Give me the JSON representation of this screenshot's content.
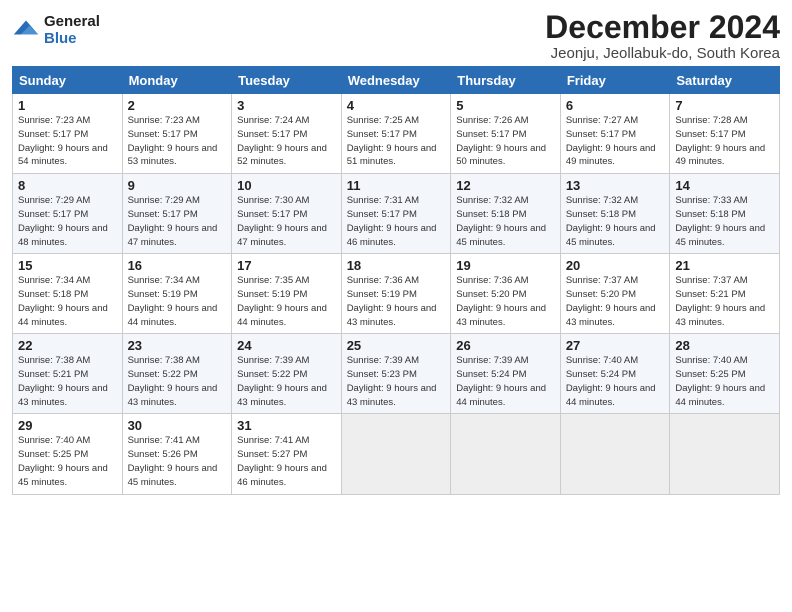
{
  "logo": {
    "general": "General",
    "blue": "Blue"
  },
  "title": {
    "month": "December 2024",
    "location": "Jeonju, Jeollabuk-do, South Korea"
  },
  "weekdays": [
    "Sunday",
    "Monday",
    "Tuesday",
    "Wednesday",
    "Thursday",
    "Friday",
    "Saturday"
  ],
  "weeks": [
    [
      {
        "day": "1",
        "sunrise": "7:23 AM",
        "sunset": "5:17 PM",
        "daylight": "9 hours and 54 minutes."
      },
      {
        "day": "2",
        "sunrise": "7:23 AM",
        "sunset": "5:17 PM",
        "daylight": "9 hours and 53 minutes."
      },
      {
        "day": "3",
        "sunrise": "7:24 AM",
        "sunset": "5:17 PM",
        "daylight": "9 hours and 52 minutes."
      },
      {
        "day": "4",
        "sunrise": "7:25 AM",
        "sunset": "5:17 PM",
        "daylight": "9 hours and 51 minutes."
      },
      {
        "day": "5",
        "sunrise": "7:26 AM",
        "sunset": "5:17 PM",
        "daylight": "9 hours and 50 minutes."
      },
      {
        "day": "6",
        "sunrise": "7:27 AM",
        "sunset": "5:17 PM",
        "daylight": "9 hours and 49 minutes."
      },
      {
        "day": "7",
        "sunrise": "7:28 AM",
        "sunset": "5:17 PM",
        "daylight": "9 hours and 49 minutes."
      }
    ],
    [
      {
        "day": "8",
        "sunrise": "7:29 AM",
        "sunset": "5:17 PM",
        "daylight": "9 hours and 48 minutes."
      },
      {
        "day": "9",
        "sunrise": "7:29 AM",
        "sunset": "5:17 PM",
        "daylight": "9 hours and 47 minutes."
      },
      {
        "day": "10",
        "sunrise": "7:30 AM",
        "sunset": "5:17 PM",
        "daylight": "9 hours and 47 minutes."
      },
      {
        "day": "11",
        "sunrise": "7:31 AM",
        "sunset": "5:17 PM",
        "daylight": "9 hours and 46 minutes."
      },
      {
        "day": "12",
        "sunrise": "7:32 AM",
        "sunset": "5:18 PM",
        "daylight": "9 hours and 45 minutes."
      },
      {
        "day": "13",
        "sunrise": "7:32 AM",
        "sunset": "5:18 PM",
        "daylight": "9 hours and 45 minutes."
      },
      {
        "day": "14",
        "sunrise": "7:33 AM",
        "sunset": "5:18 PM",
        "daylight": "9 hours and 45 minutes."
      }
    ],
    [
      {
        "day": "15",
        "sunrise": "7:34 AM",
        "sunset": "5:18 PM",
        "daylight": "9 hours and 44 minutes."
      },
      {
        "day": "16",
        "sunrise": "7:34 AM",
        "sunset": "5:19 PM",
        "daylight": "9 hours and 44 minutes."
      },
      {
        "day": "17",
        "sunrise": "7:35 AM",
        "sunset": "5:19 PM",
        "daylight": "9 hours and 44 minutes."
      },
      {
        "day": "18",
        "sunrise": "7:36 AM",
        "sunset": "5:19 PM",
        "daylight": "9 hours and 43 minutes."
      },
      {
        "day": "19",
        "sunrise": "7:36 AM",
        "sunset": "5:20 PM",
        "daylight": "9 hours and 43 minutes."
      },
      {
        "day": "20",
        "sunrise": "7:37 AM",
        "sunset": "5:20 PM",
        "daylight": "9 hours and 43 minutes."
      },
      {
        "day": "21",
        "sunrise": "7:37 AM",
        "sunset": "5:21 PM",
        "daylight": "9 hours and 43 minutes."
      }
    ],
    [
      {
        "day": "22",
        "sunrise": "7:38 AM",
        "sunset": "5:21 PM",
        "daylight": "9 hours and 43 minutes."
      },
      {
        "day": "23",
        "sunrise": "7:38 AM",
        "sunset": "5:22 PM",
        "daylight": "9 hours and 43 minutes."
      },
      {
        "day": "24",
        "sunrise": "7:39 AM",
        "sunset": "5:22 PM",
        "daylight": "9 hours and 43 minutes."
      },
      {
        "day": "25",
        "sunrise": "7:39 AM",
        "sunset": "5:23 PM",
        "daylight": "9 hours and 43 minutes."
      },
      {
        "day": "26",
        "sunrise": "7:39 AM",
        "sunset": "5:24 PM",
        "daylight": "9 hours and 44 minutes."
      },
      {
        "day": "27",
        "sunrise": "7:40 AM",
        "sunset": "5:24 PM",
        "daylight": "9 hours and 44 minutes."
      },
      {
        "day": "28",
        "sunrise": "7:40 AM",
        "sunset": "5:25 PM",
        "daylight": "9 hours and 44 minutes."
      }
    ],
    [
      {
        "day": "29",
        "sunrise": "7:40 AM",
        "sunset": "5:25 PM",
        "daylight": "9 hours and 45 minutes."
      },
      {
        "day": "30",
        "sunrise": "7:41 AM",
        "sunset": "5:26 PM",
        "daylight": "9 hours and 45 minutes."
      },
      {
        "day": "31",
        "sunrise": "7:41 AM",
        "sunset": "5:27 PM",
        "daylight": "9 hours and 46 minutes."
      },
      null,
      null,
      null,
      null
    ]
  ]
}
